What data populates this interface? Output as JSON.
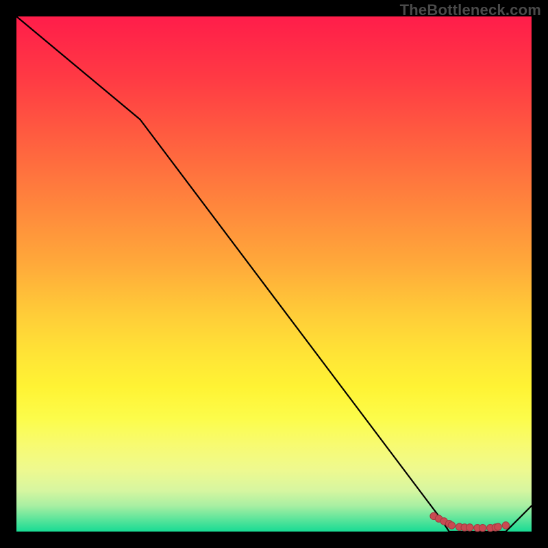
{
  "watermark": "TheBottleneck.com",
  "chart_data": {
    "type": "line",
    "title": "",
    "xlabel": "",
    "ylabel": "",
    "xlim": [
      0,
      100
    ],
    "ylim": [
      0,
      100
    ],
    "x": [
      0,
      24,
      82,
      84,
      95,
      100
    ],
    "values": [
      100,
      80,
      3,
      0,
      0,
      5
    ],
    "markers": {
      "x": [
        81,
        82,
        83,
        84,
        84.5,
        86,
        87,
        88,
        89.5,
        90.5,
        92,
        93,
        93.5,
        95
      ],
      "y": [
        3,
        2.5,
        2,
        1.5,
        1.2,
        0.9,
        0.8,
        0.8,
        0.7,
        0.7,
        0.7,
        0.8,
        0.9,
        1.2
      ]
    },
    "colors": {
      "line": "#000000",
      "marker_fill": "#c94a52",
      "marker_stroke": "#a03a40"
    }
  }
}
